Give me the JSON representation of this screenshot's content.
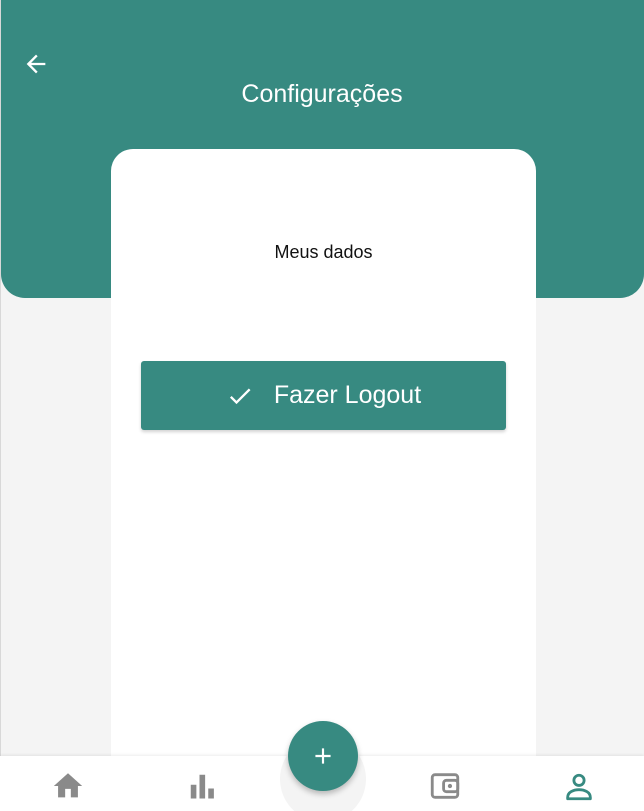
{
  "header": {
    "title": "Configurações",
    "back_icon": "arrow-left-icon"
  },
  "card": {
    "heading": "Meus dados",
    "logout_button_label": "Fazer Logout",
    "logout_icon": "check-icon"
  },
  "bottom_nav": {
    "items": [
      {
        "icon": "home-icon",
        "active": false
      },
      {
        "icon": "bar-chart-icon",
        "active": false
      },
      {
        "icon": "add-icon",
        "active": false
      },
      {
        "icon": "wallet-icon",
        "active": false
      },
      {
        "icon": "person-icon",
        "active": true
      }
    ]
  },
  "colors": {
    "primary": "#378a81",
    "background": "#f4f4f4",
    "card": "#ffffff",
    "inactive_icon": "#8a8a8a"
  }
}
